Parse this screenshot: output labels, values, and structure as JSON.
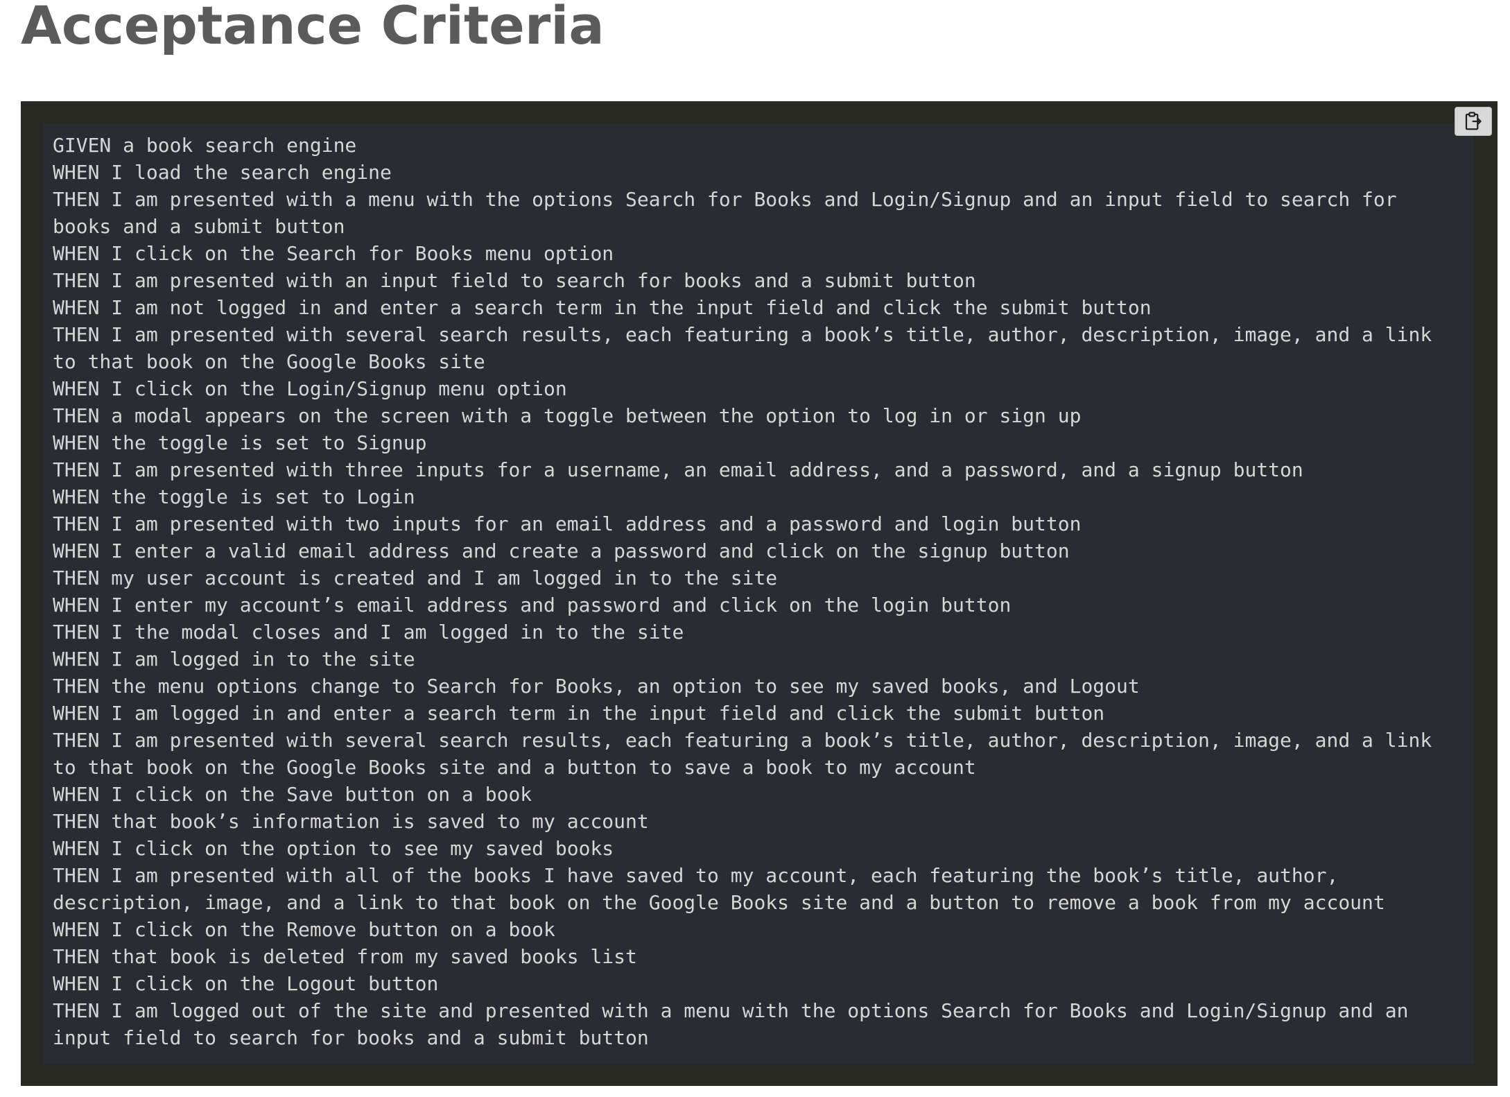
{
  "page": {
    "title": "Acceptance Criteria"
  },
  "code_block": {
    "copy_icon": "clipboard-icon",
    "lines": [
      "GIVEN a book search engine",
      "WHEN I load the search engine",
      "THEN I am presented with a menu with the options Search for Books and Login/Signup and an input field to search for books and a submit button",
      "WHEN I click on the Search for Books menu option",
      "THEN I am presented with an input field to search for books and a submit button",
      "WHEN I am not logged in and enter a search term in the input field and click the submit button",
      "THEN I am presented with several search results, each featuring a book’s title, author, description, image, and a link to that book on the Google Books site",
      "WHEN I click on the Login/Signup menu option",
      "THEN a modal appears on the screen with a toggle between the option to log in or sign up",
      "WHEN the toggle is set to Signup",
      "THEN I am presented with three inputs for a username, an email address, and a password, and a signup button",
      "WHEN the toggle is set to Login",
      "THEN I am presented with two inputs for an email address and a password and login button",
      "WHEN I enter a valid email address and create a password and click on the signup button",
      "THEN my user account is created and I am logged in to the site",
      "WHEN I enter my account’s email address and password and click on the login button",
      "THEN I the modal closes and I am logged in to the site",
      "WHEN I am logged in to the site",
      "THEN the menu options change to Search for Books, an option to see my saved books, and Logout",
      "WHEN I am logged in and enter a search term in the input field and click the submit button",
      "THEN I am presented with several search results, each featuring a book’s title, author, description, image, and a link to that book on the Google Books site and a button to save a book to my account",
      "WHEN I click on the Save button on a book",
      "THEN that book’s information is saved to my account",
      "WHEN I click on the option to see my saved books",
      "THEN I am presented with all of the books I have saved to my account, each featuring the book’s title, author, description, image, and a link to that book on the Google Books site and a button to remove a book from my account",
      "WHEN I click on the Remove button on a book",
      "THEN that book is deleted from my saved books list",
      "WHEN I click on the Logout button",
      "THEN I am logged out of the site and presented with a menu with the options Search for Books and Login/Signup and an input field to search for books and a submit button"
    ]
  }
}
